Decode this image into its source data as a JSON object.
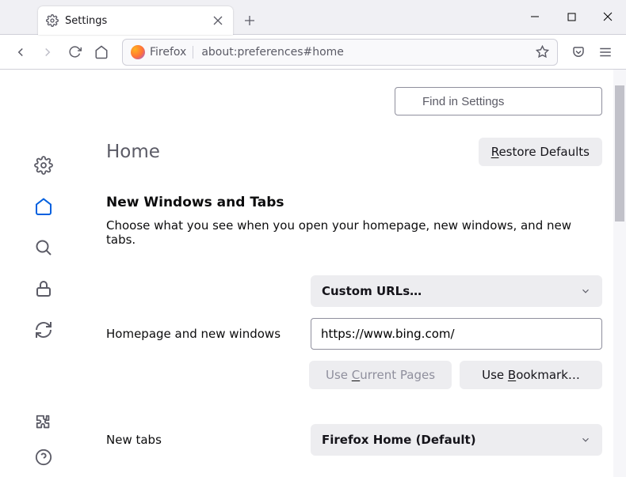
{
  "tab": {
    "title": "Settings"
  },
  "urlbar": {
    "identity": "Firefox",
    "url": "about:preferences#home"
  },
  "search": {
    "placeholder": "Find in Settings"
  },
  "page": {
    "title": "Home",
    "restore_defaults": "Restore Defaults",
    "section_title": "New Windows and Tabs",
    "section_desc": "Choose what you see when you open your homepage, new windows, and new tabs."
  },
  "homepage": {
    "label": "Homepage and new windows",
    "select_value": "Custom URLs…",
    "url": "https://www.bing.com/",
    "use_current": "Use Current Pages",
    "use_bookmark": "Use Bookmark…"
  },
  "newtabs": {
    "label": "New tabs",
    "select_value": "Firefox Home (Default)"
  }
}
